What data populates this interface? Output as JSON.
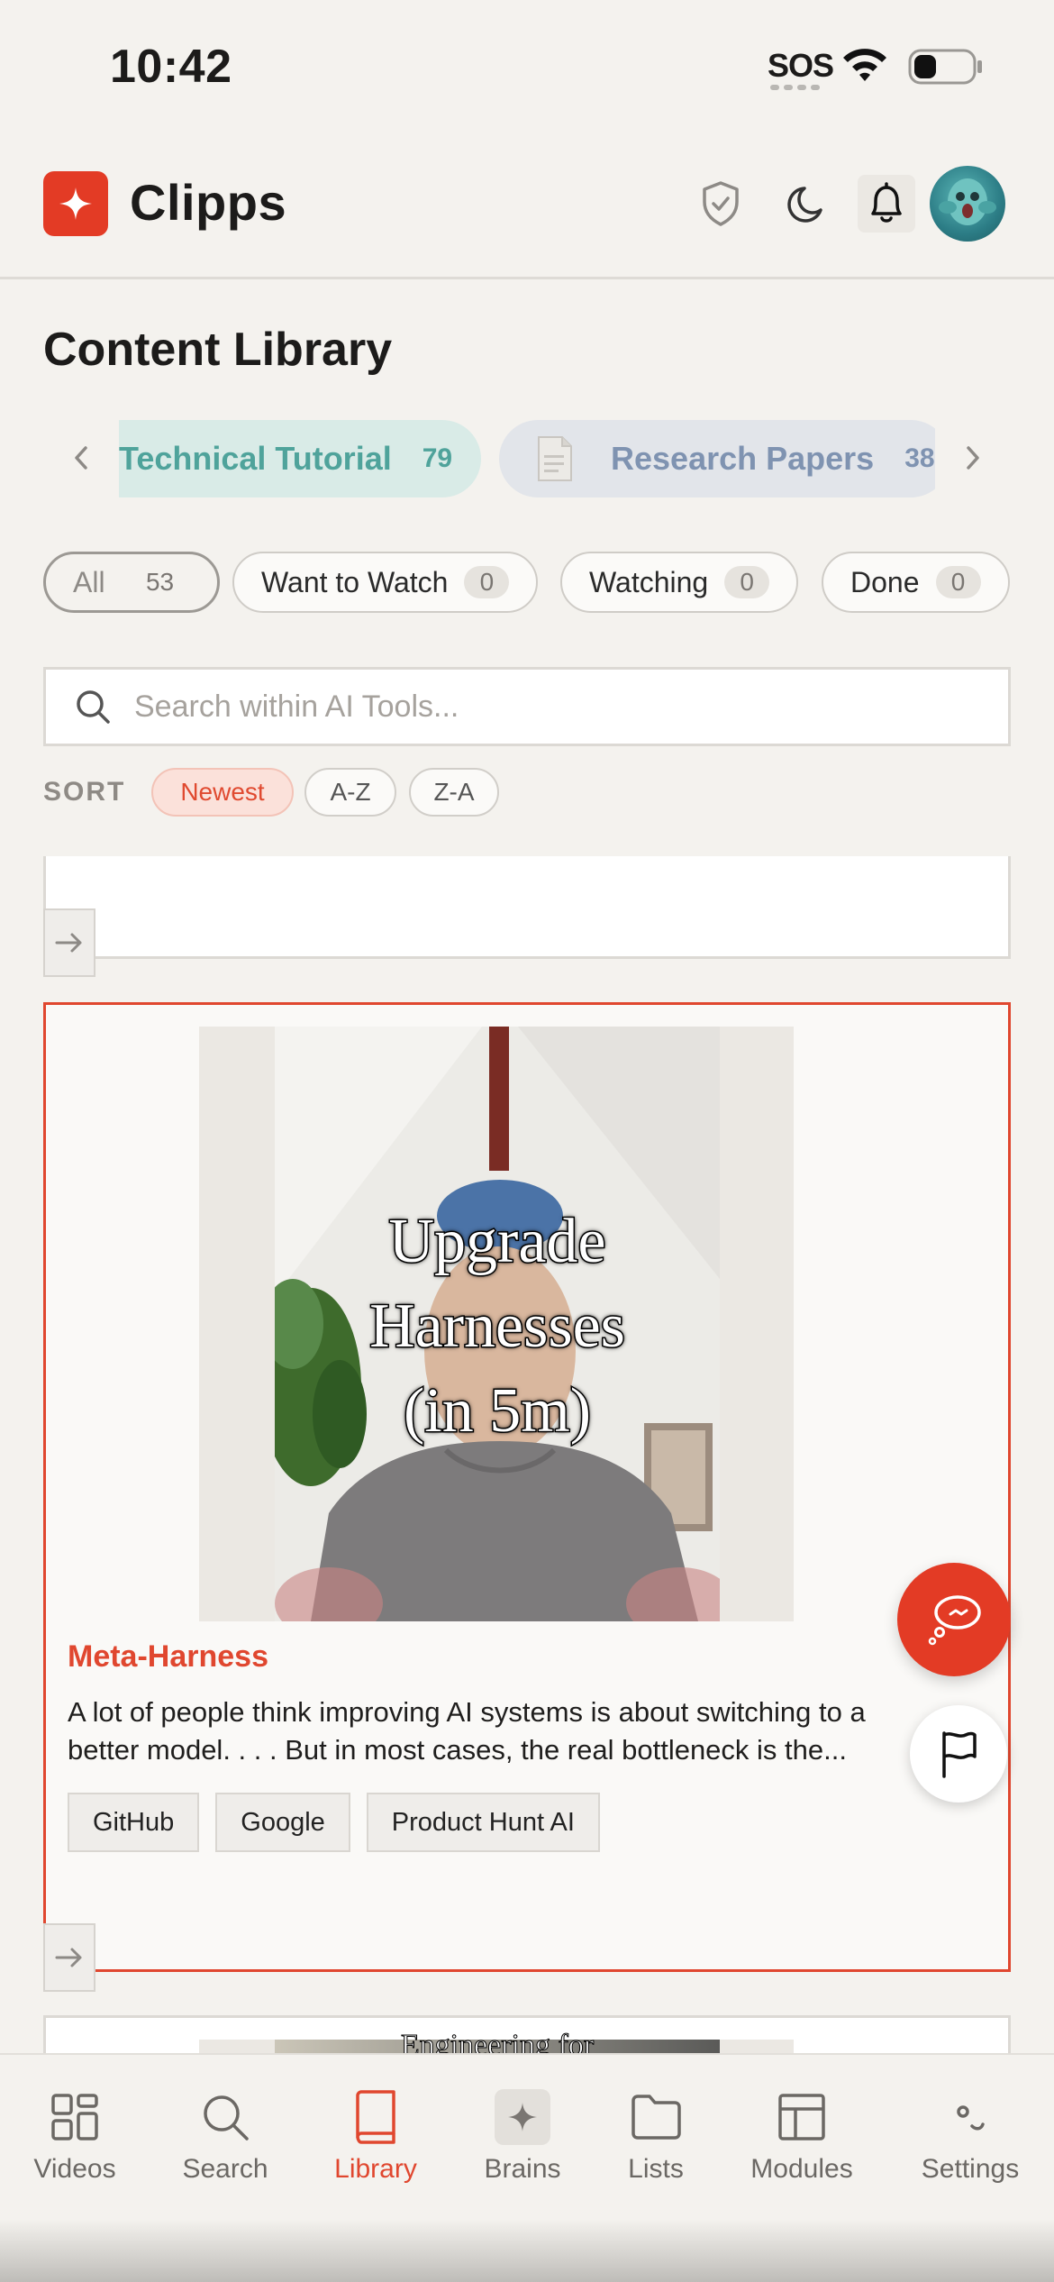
{
  "status": {
    "time": "10:42",
    "sos": "SOS"
  },
  "app": {
    "name": "Clipps"
  },
  "page": {
    "title": "Content Library"
  },
  "categories": [
    {
      "label": "Technical Tutorial",
      "count": "79"
    },
    {
      "label": "Research Papers",
      "count": "38"
    }
  ],
  "filters": [
    {
      "label": "All",
      "count": "53"
    },
    {
      "label": "Want to Watch",
      "count": "0"
    },
    {
      "label": "Watching",
      "count": "0"
    },
    {
      "label": "Done",
      "count": "0"
    }
  ],
  "search": {
    "placeholder": "Search within AI Tools..."
  },
  "sort": {
    "label": "SORT",
    "options": [
      "Newest",
      "A-Z",
      "Z-A"
    ],
    "selected": "Newest"
  },
  "card": {
    "thumbnail_text": [
      "Upgrade",
      "Harnesses",
      "(in 5m)"
    ],
    "title": "Meta-Harness",
    "description": "A lot of people think improving AI systems is about switching to a better model. . . . But in most cases, the real bottleneck is the...",
    "tags": [
      "GitHub",
      "Google",
      "Product Hunt AI"
    ]
  },
  "next_card": {
    "thumbnail_text": "Engineering for"
  },
  "nav": {
    "items": [
      "Videos",
      "Search",
      "Library",
      "Brains",
      "Lists",
      "Modules",
      "Settings"
    ],
    "active": "Library"
  },
  "colors": {
    "accent": "#e33b25",
    "teal": "#4fa39b",
    "slate": "#7f93b1"
  }
}
